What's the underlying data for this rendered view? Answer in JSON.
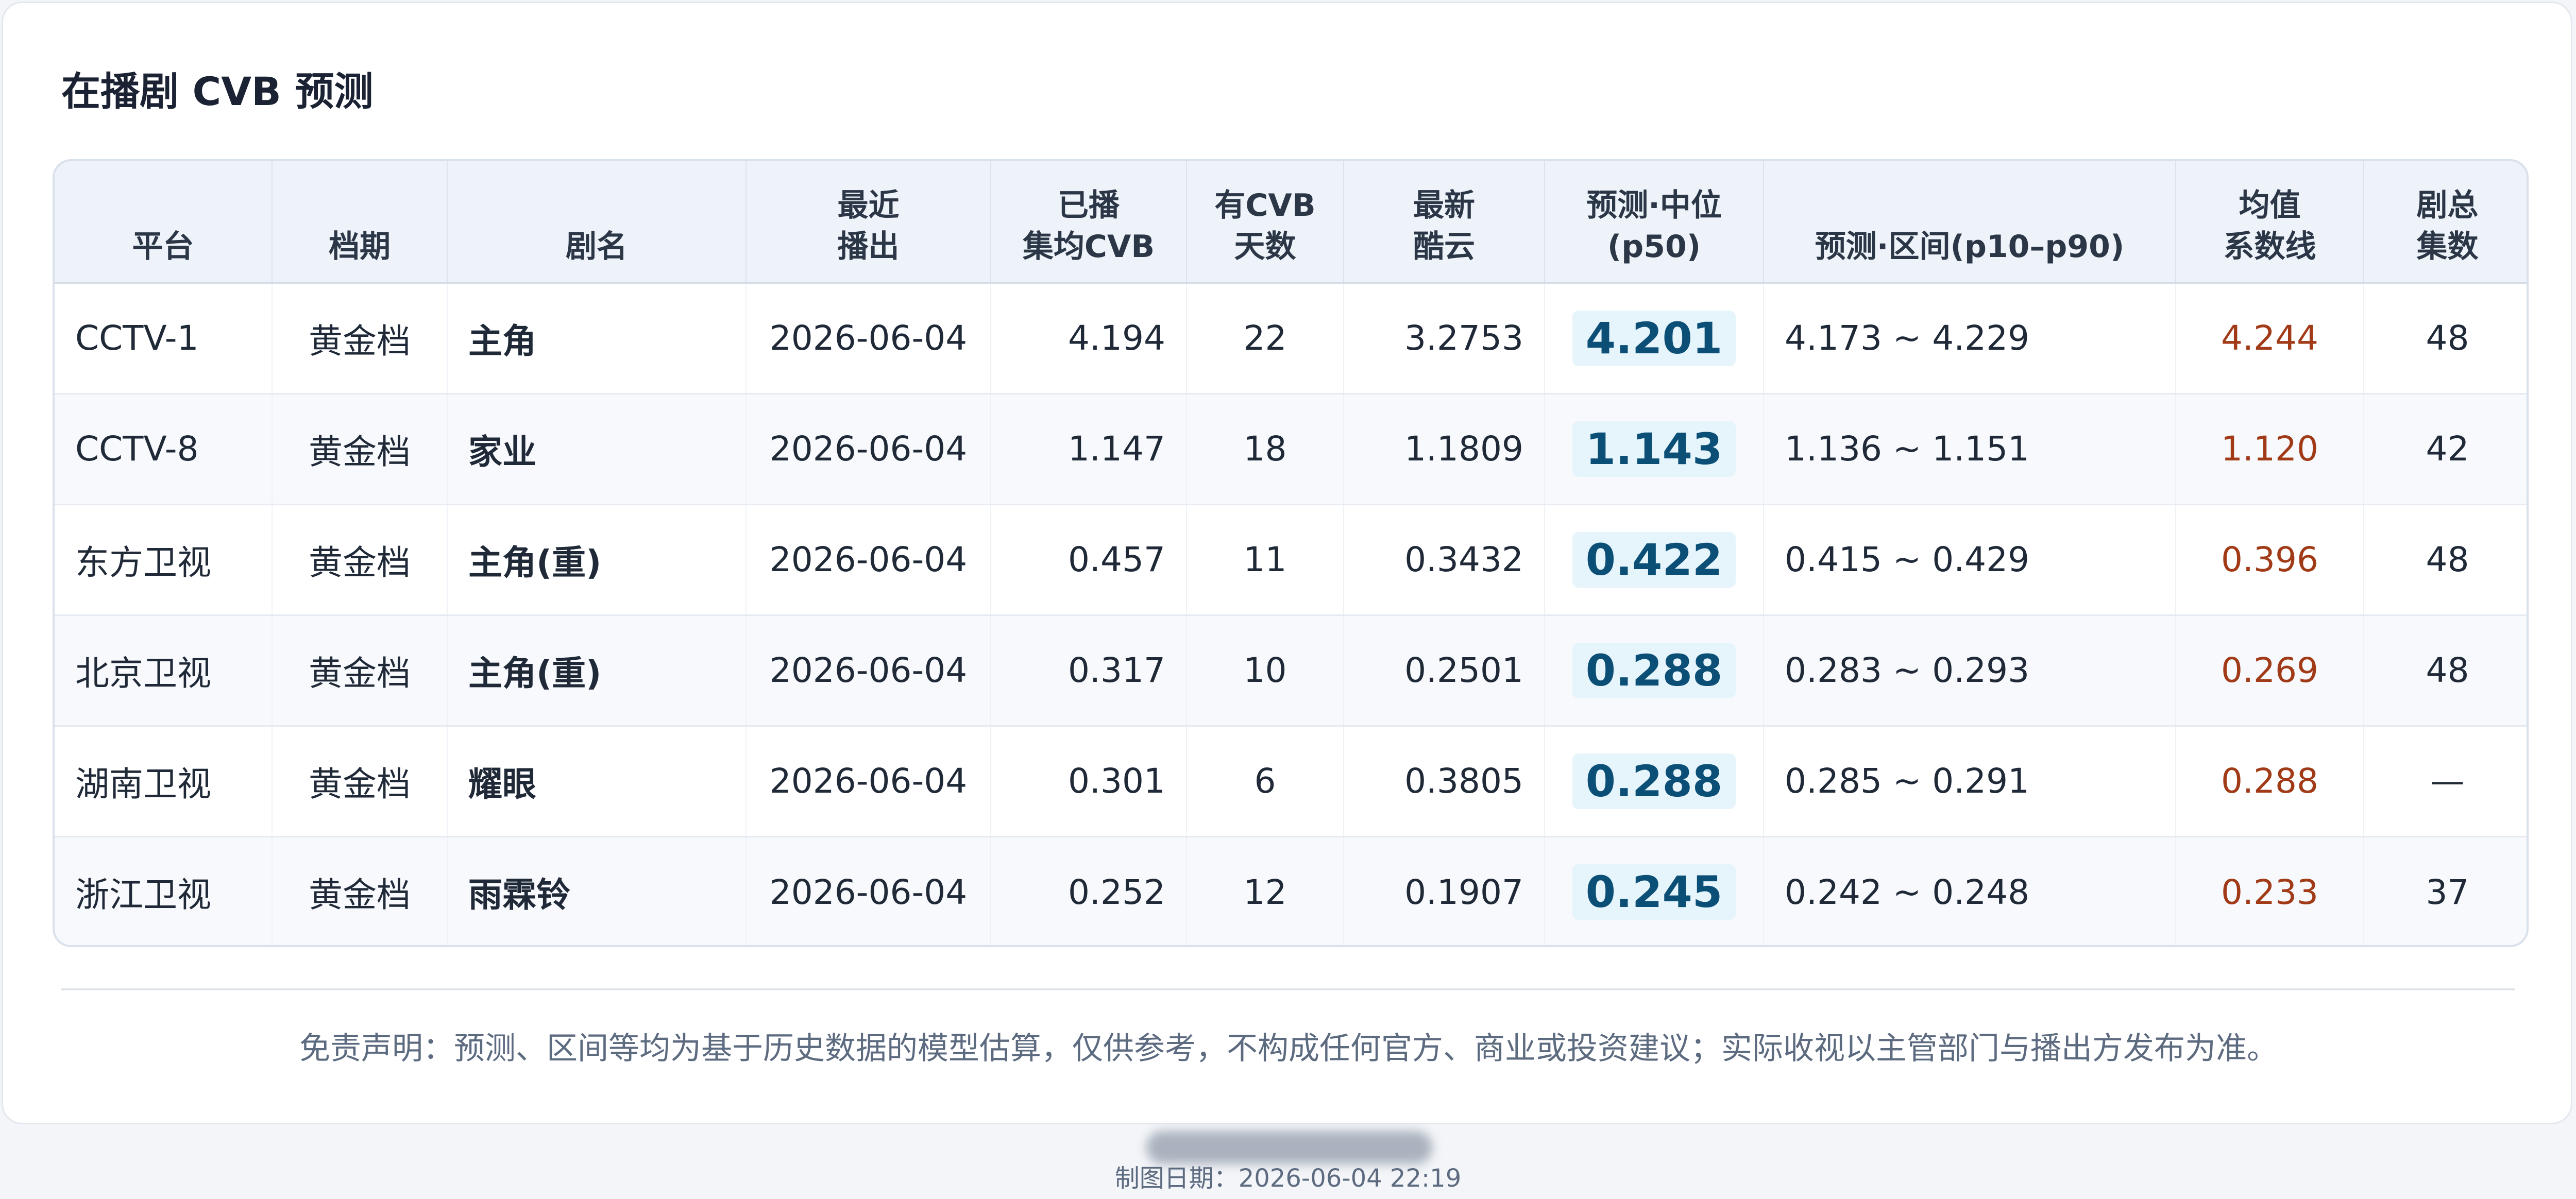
{
  "title": "在播剧 CVB 预测",
  "columns": [
    {
      "line1": "平台",
      "line2": ""
    },
    {
      "line1": "档期",
      "line2": ""
    },
    {
      "line1": "剧名",
      "line2": ""
    },
    {
      "line1": "最近",
      "line2": "播出"
    },
    {
      "line1": "已播",
      "line2": "集均CVB"
    },
    {
      "line1": "有CVB",
      "line2": "天数"
    },
    {
      "line1": "最新",
      "line2": "酷云"
    },
    {
      "line1": "预测·中位",
      "line2": "(p50)"
    },
    {
      "line1": "预测·区间(p10–p90)",
      "line2": ""
    },
    {
      "line1": "均值",
      "line2": "系数线"
    },
    {
      "line1": "剧总",
      "line2": "集数"
    }
  ],
  "rows": [
    {
      "platform": "CCTV-1",
      "slot": "黄金档",
      "drama": "主角",
      "last_aired": "2026-06-04",
      "avg_cvb": "4.194",
      "cvb_days": "22",
      "latest_kuyun": "3.2753",
      "p50": "4.201",
      "range": "4.173 ~ 4.229",
      "mean_line": "4.244",
      "episodes": "48"
    },
    {
      "platform": "CCTV-8",
      "slot": "黄金档",
      "drama": "家业",
      "last_aired": "2026-06-04",
      "avg_cvb": "1.147",
      "cvb_days": "18",
      "latest_kuyun": "1.1809",
      "p50": "1.143",
      "range": "1.136 ~ 1.151",
      "mean_line": "1.120",
      "episodes": "42"
    },
    {
      "platform": "东方卫视",
      "slot": "黄金档",
      "drama": "主角(重)",
      "last_aired": "2026-06-04",
      "avg_cvb": "0.457",
      "cvb_days": "11",
      "latest_kuyun": "0.3432",
      "p50": "0.422",
      "range": "0.415 ~ 0.429",
      "mean_line": "0.396",
      "episodes": "48"
    },
    {
      "platform": "北京卫视",
      "slot": "黄金档",
      "drama": "主角(重)",
      "last_aired": "2026-06-04",
      "avg_cvb": "0.317",
      "cvb_days": "10",
      "latest_kuyun": "0.2501",
      "p50": "0.288",
      "range": "0.283 ~ 0.293",
      "mean_line": "0.269",
      "episodes": "48"
    },
    {
      "platform": "湖南卫视",
      "slot": "黄金档",
      "drama": "耀眼",
      "last_aired": "2026-06-04",
      "avg_cvb": "0.301",
      "cvb_days": "6",
      "latest_kuyun": "0.3805",
      "p50": "0.288",
      "range": "0.285 ~ 0.291",
      "mean_line": "0.288",
      "episodes": "—"
    },
    {
      "platform": "浙江卫视",
      "slot": "黄金档",
      "drama": "雨霖铃",
      "last_aired": "2026-06-04",
      "avg_cvb": "0.252",
      "cvb_days": "12",
      "latest_kuyun": "0.1907",
      "p50": "0.245",
      "range": "0.242 ~ 0.248",
      "mean_line": "0.233",
      "episodes": "37"
    }
  ],
  "disclaimer": "免责声明：预测、区间等均为基于历史数据的模型估算，仅供参考，不构成任何官方、商业或投资建议；实际收视以主管部门与播出方发布为准。",
  "footer": "制图日期：2026-06-04 22:19",
  "colors": {
    "accent": "#0b4f77",
    "mean_line": "#a13b17",
    "header_bg": "#eef3f9"
  }
}
